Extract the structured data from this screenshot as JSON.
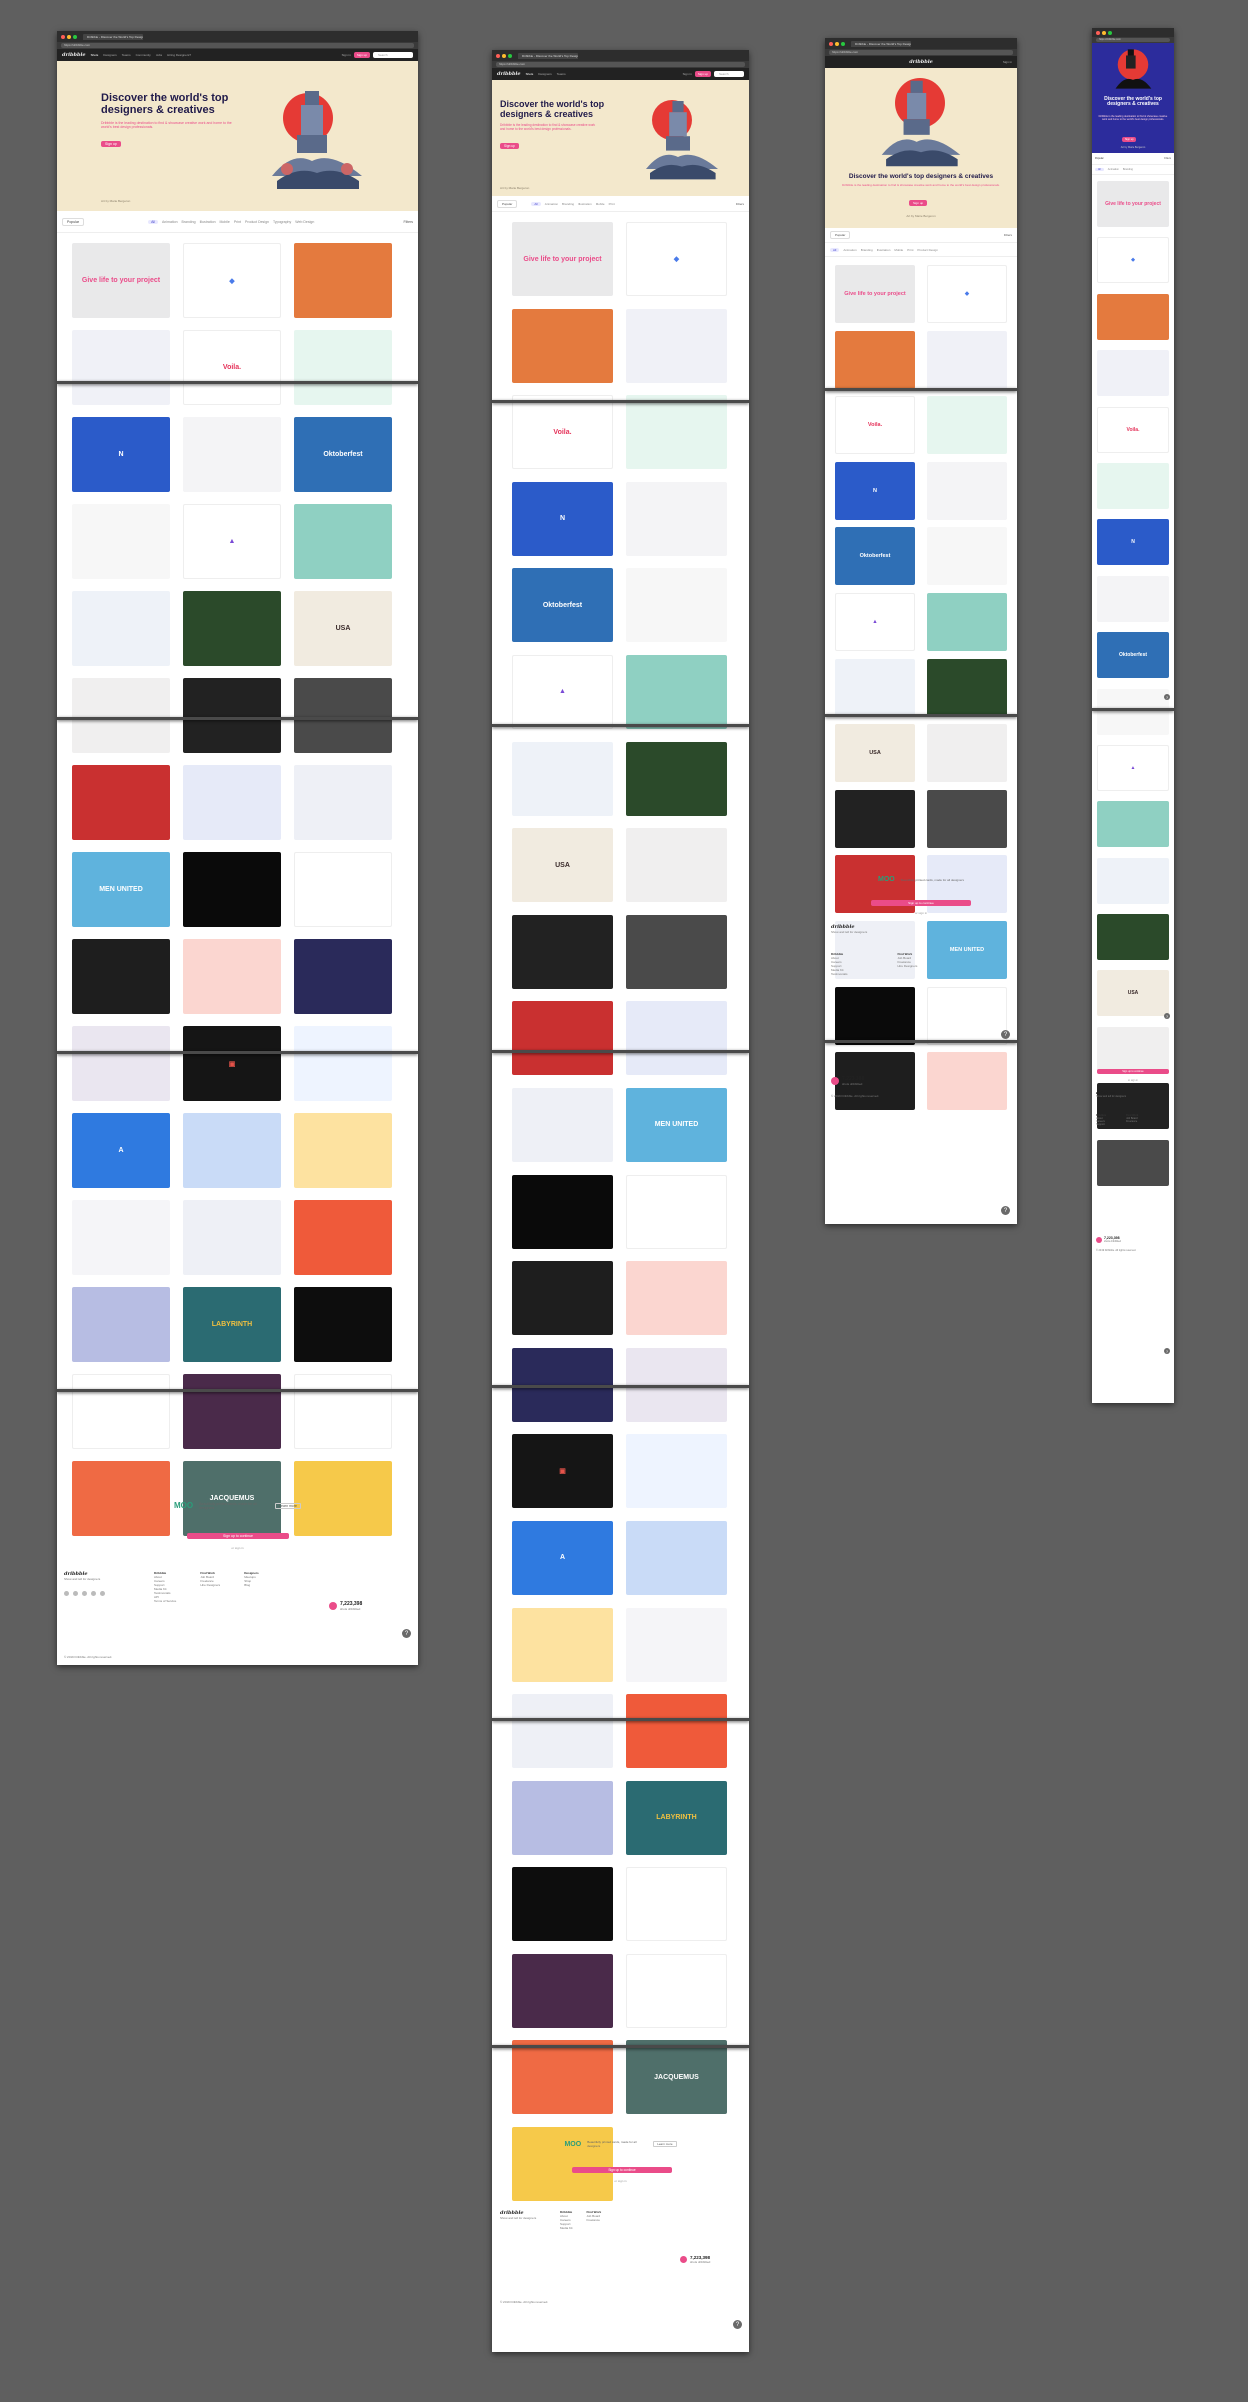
{
  "browser": {
    "tab_label": "Dribbble - Discover the World's Top Designers & Creative Professionals",
    "url": "https://dribbble.com"
  },
  "nav": {
    "logo": "dribbble",
    "links": [
      "Shots",
      "Designers",
      "Teams",
      "Community",
      "Jobs",
      "Hiring Designers?"
    ],
    "sign_in": "Sign in",
    "sign_up": "Sign up",
    "search_placeholder": "Search"
  },
  "hero": {
    "title_line1": "Discover the world's top",
    "title_line2": "designers & creatives",
    "title_full": "Discover the world's top designers & creatives",
    "description": "Dribbble is the leading destination to find & showcase creative work and home to the world's best design professionals.",
    "button": "Sign up",
    "credit": "Art by Marie Bergeron"
  },
  "filters": {
    "sort": "Popular",
    "categories": [
      "All",
      "Animation",
      "Branding",
      "Illustration",
      "Mobile",
      "Print",
      "Product Design",
      "Typography",
      "Web Design"
    ],
    "filters_label": "Filters"
  },
  "shots": [
    {
      "label": "Give life to your project",
      "bg": "#e9e9ea",
      "fg": "#ea4c89"
    },
    {
      "label": "◆",
      "bg": "#ffffff",
      "fg": "#4a7bea"
    },
    {
      "label": "",
      "bg": "#e47a3e",
      "fg": "#7a2a1a"
    },
    {
      "label": "",
      "bg": "#f0f1f7",
      "fg": "#444"
    },
    {
      "label": "Voila.",
      "bg": "#ffffff",
      "fg": "#e5335a"
    },
    {
      "label": "",
      "bg": "#e6f6ef",
      "fg": "#3acb8e"
    },
    {
      "label": "N",
      "bg": "#2b5bc9",
      "fg": "#ffffff"
    },
    {
      "label": "",
      "bg": "#f4f4f6",
      "fg": "#999"
    },
    {
      "label": "Oktoberfest",
      "bg": "#2f6fb5",
      "fg": "#ffffff"
    },
    {
      "label": "",
      "bg": "#f7f7f7",
      "fg": "#bbb"
    },
    {
      "label": "▲",
      "bg": "#ffffff",
      "fg": "#7a4ad6"
    },
    {
      "label": "",
      "bg": "#8fd0c2",
      "fg": "#245"
    },
    {
      "label": "",
      "bg": "#eef2f8",
      "fg": "#99a"
    },
    {
      "label": "",
      "bg": "#2b4a2a",
      "fg": "#f0c040"
    },
    {
      "label": "USA",
      "bg": "#f1ebe0",
      "fg": "#3a2a2a"
    },
    {
      "label": "",
      "bg": "#f0efef",
      "fg": "#333"
    },
    {
      "label": "",
      "bg": "#222222",
      "fg": "#eee"
    },
    {
      "label": "",
      "bg": "#4a4a4a",
      "fg": "#b88"
    },
    {
      "label": "",
      "bg": "#c93030",
      "fg": "#fff"
    },
    {
      "label": "",
      "bg": "#e6eaf8",
      "fg": "#2b5bc9"
    },
    {
      "label": "",
      "bg": "#eef0f6",
      "fg": "#7a6af0"
    },
    {
      "label": "MEN UNITED",
      "bg": "#5fb3dd",
      "fg": "#ffffff"
    },
    {
      "label": "",
      "bg": "#0a0a0a",
      "fg": "#a06af0"
    },
    {
      "label": "",
      "bg": "#ffffff",
      "fg": "#e5534a"
    },
    {
      "label": "",
      "bg": "#1e1e1e",
      "fg": "#eee"
    },
    {
      "label": "",
      "bg": "#fbd6d0",
      "fg": "#1e2a4a"
    },
    {
      "label": "",
      "bg": "#2a2a5a",
      "fg": "#ef5a4a"
    },
    {
      "label": "",
      "bg": "#eae6f0",
      "fg": "#c55"
    },
    {
      "label": "▣",
      "bg": "#151515",
      "fg": "#e5534a"
    },
    {
      "label": "",
      "bg": "#eef4ff",
      "fg": "#2b5bc9"
    },
    {
      "label": "A",
      "bg": "#2f7ae0",
      "fg": "#ffffff"
    },
    {
      "label": "",
      "bg": "#c9dbf7",
      "fg": "#333"
    },
    {
      "label": "",
      "bg": "#fde2a0",
      "fg": "#e5534a"
    },
    {
      "label": "",
      "bg": "#f5f5f8",
      "fg": "#555"
    },
    {
      "label": "",
      "bg": "#eef0f6",
      "fg": "#7a6af0"
    },
    {
      "label": "",
      "bg": "#ef5a3a",
      "fg": "#2b5bc9"
    },
    {
      "label": "",
      "bg": "#b7bde3",
      "fg": "#2b5bc9"
    },
    {
      "label": "LABYRINTH",
      "bg": "#2b6b72",
      "fg": "#f0c040"
    },
    {
      "label": "",
      "bg": "#0d0d0d",
      "fg": "#4a7bea"
    },
    {
      "label": "",
      "bg": "#ffffff",
      "fg": "#f0c040"
    },
    {
      "label": "",
      "bg": "#4a2a4a",
      "fg": "#c8a"
    },
    {
      "label": "",
      "bg": "#ffffff",
      "fg": "#a0522d"
    },
    {
      "label": "",
      "bg": "#ef6a44",
      "fg": "#fff"
    },
    {
      "label": "JACQUEMUS",
      "bg": "#4f6f6a",
      "fg": "#ffffff"
    },
    {
      "label": "",
      "bg": "#f6c94a",
      "fg": "#222"
    }
  ],
  "ad": {
    "brand": "MOO",
    "text": "Beautifully printed cards, made for all designers",
    "button": "Learn more"
  },
  "signup_bar": {
    "label": "Sign up to continue",
    "signin_text": "or sign in"
  },
  "footer": {
    "logo": "dribbble",
    "tagline": "Show and tell for designers",
    "columns": [
      {
        "title": "Dribbble",
        "items": [
          "About",
          "Careers",
          "Support",
          "Media Kit",
          "Testimonials",
          "API",
          "Terms of Service"
        ]
      },
      {
        "title": "Find Work",
        "items": [
          "Job Board",
          "Freelance",
          "Hire Designers"
        ]
      },
      {
        "title": "Designers",
        "items": [
          "Meetups",
          "Shop",
          "Blog"
        ]
      }
    ],
    "stat_value": "7,223,398",
    "stat_label": "shots dribbbled",
    "copyright": "© 2019 Dribbble. All rights reserved."
  },
  "colors": {
    "brand_pink": "#ea4c89",
    "hero_bg": "#f3e8cc",
    "hero_title": "#201a4a",
    "canvas_bg": "#5f5f5f"
  }
}
